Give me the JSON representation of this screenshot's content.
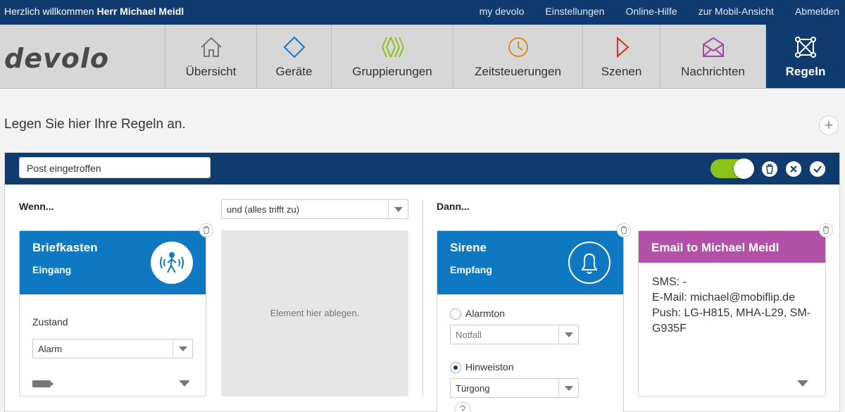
{
  "topbar": {
    "greeting": "Herzlich willkommen",
    "user": "Herr Michael Meidl",
    "links": [
      "my devolo",
      "Einstellungen",
      "Online-Hilfe",
      "zur Mobil-Ansicht",
      "Abmelden"
    ]
  },
  "nav": {
    "logo": "devolo",
    "items": [
      {
        "label": "Übersicht",
        "icon": "home-icon",
        "color": "#777777"
      },
      {
        "label": "Geräte",
        "icon": "device-diamond-icon",
        "color": "#1a78c2"
      },
      {
        "label": "Gruppierungen",
        "icon": "groups-icon",
        "color": "#8cc21c"
      },
      {
        "label": "Zeitsteuerungen",
        "icon": "clock-icon",
        "color": "#e08a1e"
      },
      {
        "label": "Szenen",
        "icon": "play-icon",
        "color": "#d0302a"
      },
      {
        "label": "Nachrichten",
        "icon": "envelope-icon",
        "color": "#a44a9c"
      },
      {
        "label": "Regeln",
        "icon": "rules-network-icon",
        "color": "#ffffff"
      }
    ]
  },
  "intro": "Legen Sie hier Ihre Regeln an.",
  "rule": {
    "name": "Post eingetroffen",
    "enabled": true,
    "when_label": "Wenn...",
    "then_label": "Dann...",
    "condition_select": "und (alles trifft zu)",
    "dropzone": "Element hier ablegen.",
    "trigger": {
      "title": "Briefkasten",
      "subtitle": "Eingang",
      "state_label": "Zustand",
      "state_value": "Alarm"
    },
    "siren": {
      "title": "Sirene",
      "subtitle": "Empfang",
      "alarm_label": "Alarmton",
      "alarm_value": "Notfall",
      "hint_label": "Hinweiston",
      "hint_value": "Türgong",
      "selected": "Hinweiston"
    },
    "email": {
      "title": "Email to Michael Meidl",
      "sms": "SMS: -",
      "mail": "E-Mail: michael@mobiflip.de",
      "push": "Push: LG-H815, MHA-L29, SM-G935F"
    }
  },
  "colors": {
    "navy": "#0f3b6e",
    "blue": "#0e78c2",
    "purple": "#b351a8",
    "green": "#8cc21c"
  }
}
